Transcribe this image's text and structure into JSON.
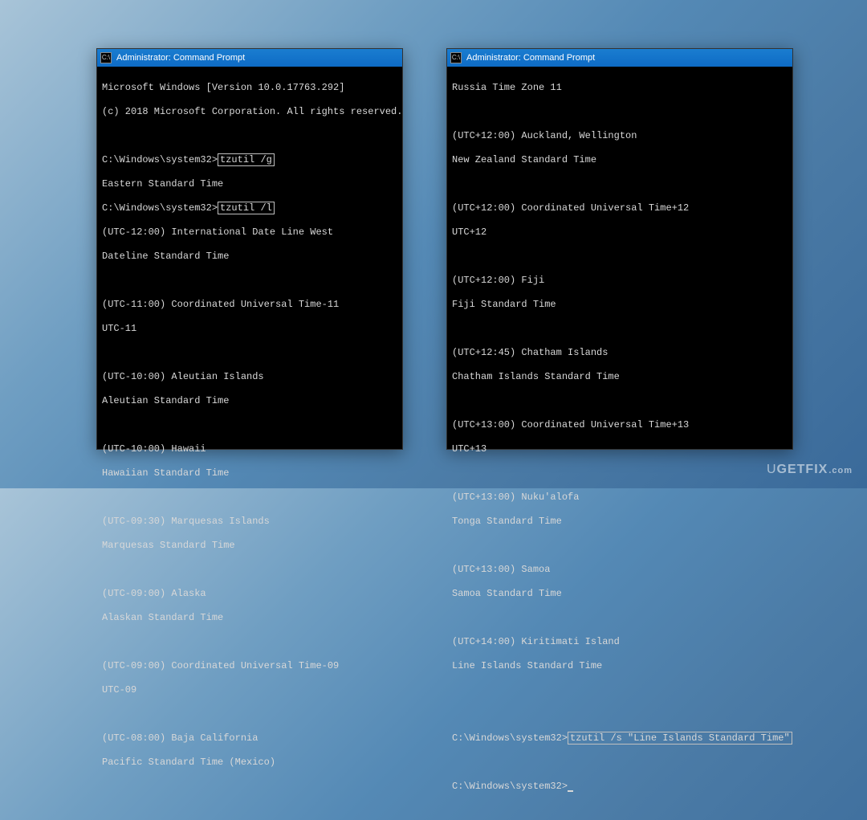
{
  "watermark": {
    "lead": "U",
    "main": "GETFIX",
    "trail": ".com"
  },
  "left": {
    "title": "Administrator: Command Prompt",
    "l1": "Microsoft Windows [Version 10.0.17763.292]",
    "l2": "(c) 2018 Microsoft Corporation. All rights reserved.",
    "blank": "",
    "prompt1_pre": "C:\\Windows\\system32>",
    "prompt1_cmd": "tzutil /g",
    "l4": "Eastern Standard Time",
    "prompt2_pre": "C:\\Windows\\system32>",
    "prompt2_cmd": "tzutil /l",
    "l6": "(UTC-12:00) International Date Line West",
    "l7": "Dateline Standard Time",
    "l9": "(UTC-11:00) Coordinated Universal Time-11",
    "l10": "UTC-11",
    "l12": "(UTC-10:00) Aleutian Islands",
    "l13": "Aleutian Standard Time",
    "l15": "(UTC-10:00) Hawaii",
    "l16": "Hawaiian Standard Time",
    "l18": "(UTC-09:30) Marquesas Islands",
    "l19": "Marquesas Standard Time",
    "l21": "(UTC-09:00) Alaska",
    "l22": "Alaskan Standard Time",
    "l24": "(UTC-09:00) Coordinated Universal Time-09",
    "l25": "UTC-09",
    "l27": "(UTC-08:00) Baja California",
    "l28": "Pacific Standard Time (Mexico)"
  },
  "right": {
    "title": "Administrator: Command Prompt",
    "l1": "Russia Time Zone 11",
    "blank": "",
    "l3": "(UTC+12:00) Auckland, Wellington",
    "l4": "New Zealand Standard Time",
    "l6": "(UTC+12:00) Coordinated Universal Time+12",
    "l7": "UTC+12",
    "l9": "(UTC+12:00) Fiji",
    "l10": "Fiji Standard Time",
    "l12": "(UTC+12:45) Chatham Islands",
    "l13": "Chatham Islands Standard Time",
    "l15": "(UTC+13:00) Coordinated Universal Time+13",
    "l16": "UTC+13",
    "l18": "(UTC+13:00) Nuku'alofa",
    "l19": "Tonga Standard Time",
    "l21": "(UTC+13:00) Samoa",
    "l22": "Samoa Standard Time",
    "l24": "(UTC+14:00) Kiritimati Island",
    "l25": "Line Islands Standard Time",
    "prompt1_pre": "C:\\Windows\\system32>",
    "prompt1_cmd": "tzutil /s \"Line Islands Standard Time\"",
    "prompt2": "C:\\Windows\\system32>"
  }
}
